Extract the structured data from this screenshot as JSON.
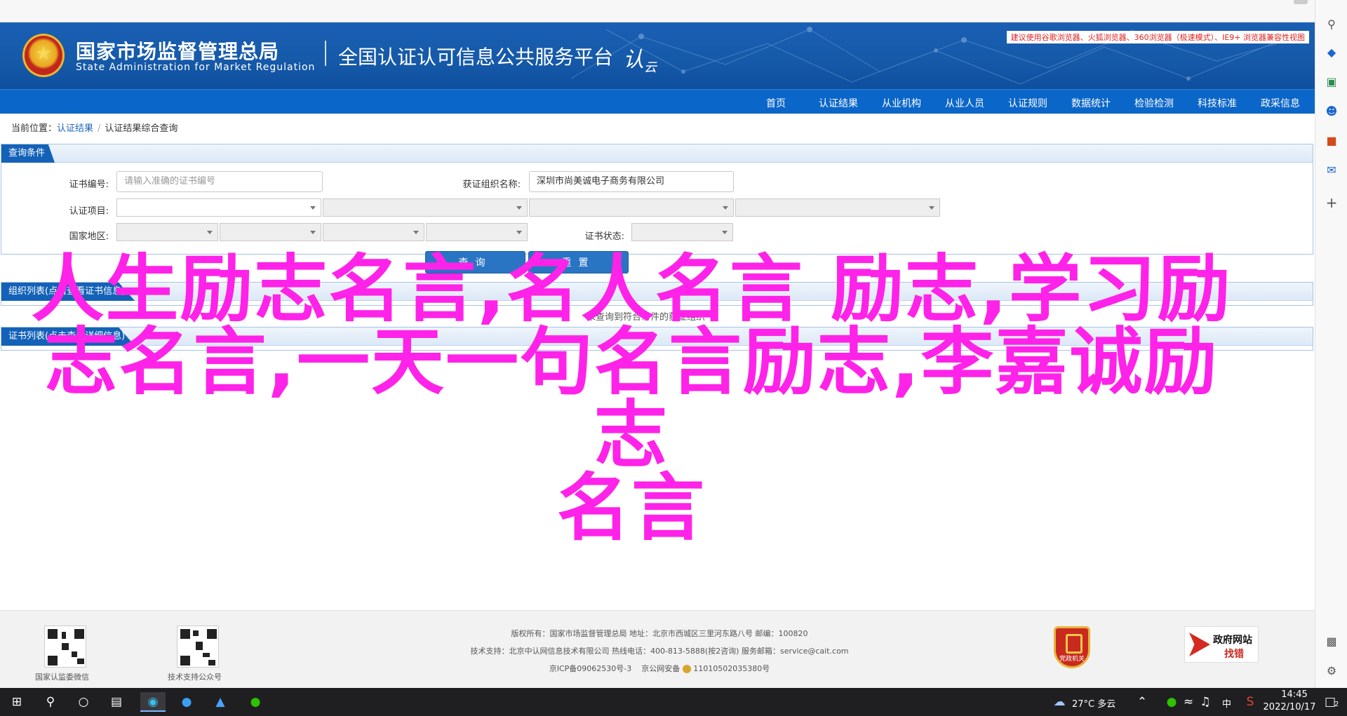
{
  "browser_note": "建议使用谷歌浏览器、火狐浏览器、360浏览器（极速模式）、IE9+ 浏览器兼容性视图",
  "header": {
    "org_cn": "国家市场监督管理总局",
    "org_en": "State Administration  for  Market Regulation",
    "platform": "全国认证认可信息公共服务平台",
    "platform_logo": "认云"
  },
  "nav": [
    "首页",
    "认证结果",
    "从业机构",
    "从业人员",
    "认证规则",
    "数据统计",
    "检验检测",
    "科技标准",
    "政采信息"
  ],
  "breadcrumb": {
    "label": "当前位置：",
    "level1": "认证结果",
    "level2": "认证结果综合查询"
  },
  "query": {
    "panel_title": "查询条件",
    "cert_no_label": "证书编号:",
    "cert_no_placeholder": "请输入准确的证书编号",
    "org_name_label": "获证组织名称:",
    "org_name_value": "深圳市尚美诚电子商务有限公司",
    "project_label": "认证项目:",
    "region_label": "国家地区:",
    "status_label": "证书状态:",
    "search_button": "查询",
    "reset_button": "重置"
  },
  "org_list": {
    "panel_title": "组织列表(点击查看证书信息)",
    "empty_text": "未查询到符合条件的获证组织"
  },
  "cert_list": {
    "panel_title": "证书列表(点击查看详细信息)"
  },
  "overlay": {
    "line1": "人生励志名言,名人名言 励志,学习励",
    "line2": "志名言,一天一句名言励志,李嘉诚励志",
    "line3": "名言"
  },
  "footer": {
    "qr1_caption": "国家认监委微信",
    "qr2_caption": "技术支持公众号",
    "line1": "版权所有：国家市场监督管理总局    地址：北京市西城区三里河东路八号    邮编：100820",
    "line2": "技术支持：北京中认网信息技术有限公司    热线电话：400-813-5888(按2咨询)    服务邮箱：service@cait.com",
    "line3_icp": "京ICP备09062530号-3",
    "line3_police": "京公网安备",
    "line3_police_no": "11010502035380号",
    "badge_text": "党政机关",
    "gov_title": "政府网站",
    "gov_sub": "找错"
  },
  "taskbar": {
    "weather": "27°C 多云",
    "ime": "中",
    "time": "14:45",
    "date": "2022/10/17",
    "notification_count": "2"
  },
  "colors": {
    "header_blue": "#1559a8",
    "nav_blue": "#0b66c9",
    "tab_blue": "#1462b8",
    "overlay_magenta": "#ff22e8"
  }
}
